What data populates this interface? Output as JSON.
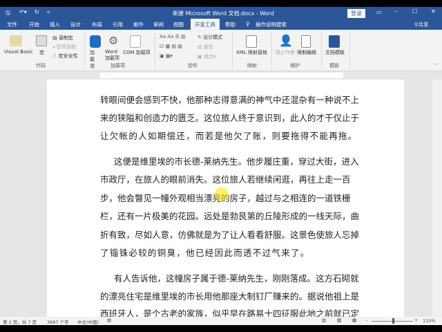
{
  "titlebar": {
    "title": "新建 Microsoft Word 文档.docx - Word",
    "login": "登录"
  },
  "tabs": [
    "文件",
    "开始",
    "插入",
    "设计",
    "布局",
    "引用",
    "邮件",
    "审阅",
    "视图",
    "开发工具",
    "帮助",
    "操作说明搜索"
  ],
  "share": "共享",
  "ribbon": {
    "code": {
      "visual_basic": "Visual Basic",
      "macro": "宏",
      "record": "录制宏",
      "pause": "暂停录制",
      "security": "宏安全性",
      "group": "代码"
    },
    "addins": {
      "addin": "加载项",
      "word_addin": "Word 加载项",
      "com_addin": "COM 加载项",
      "group": "加载项"
    },
    "controls": {
      "design": "设计模式",
      "properties": "属性",
      "group_btn": "组合",
      "group": "控件"
    },
    "mapping": {
      "xml": "XML 映射窗格",
      "group": "映射"
    },
    "protect": {
      "block": "阻止作者",
      "restrict": "限制编辑",
      "group": "保护"
    },
    "templates": {
      "doc_template": "文档模板",
      "group": "模板"
    }
  },
  "document": {
    "lines": [
      "转眼间便会感到不快，他那种志得意满的神气中还混杂有一种说不上",
      "来的狭隘和创造力的匮乏。这位旅人终于意识到，此人的才干仅止于",
      "让欠帐的人如期偿还，而若是他欠了账，则要拖得不能再拖。",
      "这便是维里埃的市长德-莱纳先生。他步履庄重，穿过大街，进入",
      "市政厅，在旅人的眼前消失。这位旅人若继续闲逛，再往上走一百",
      "步，他会瞥见一幢外观相当漂亮的房子，越过与之相连的一道铁栅",
      "栏，还有一片极美的花园。远处是勃艮第的丘陵形成的一线天际，曲",
      "折有致，尽如人意，仿佛就是为了让人看看舒服。这景色使旅人忘掉",
      "了锱铢必较的铜臭，他已经因此而透不过气来了。",
      "有人告诉他，这幢房子属于德-莱纳先生，刚刚落成。这方石砌就",
      "的漂亮住宅是维里埃的市长用他那座大制钉厂赚来的。据说他祖上是",
      "西班牙人，是个古老的家族，似乎早在路易十四征服此地之前就已定"
    ]
  },
  "status": {
    "page": "第 2 页，共 7 页",
    "words": "3687 个字",
    "lang": "中文(中国)",
    "zoom": "110%"
  },
  "colors": {
    "accent": "#2b579a"
  }
}
